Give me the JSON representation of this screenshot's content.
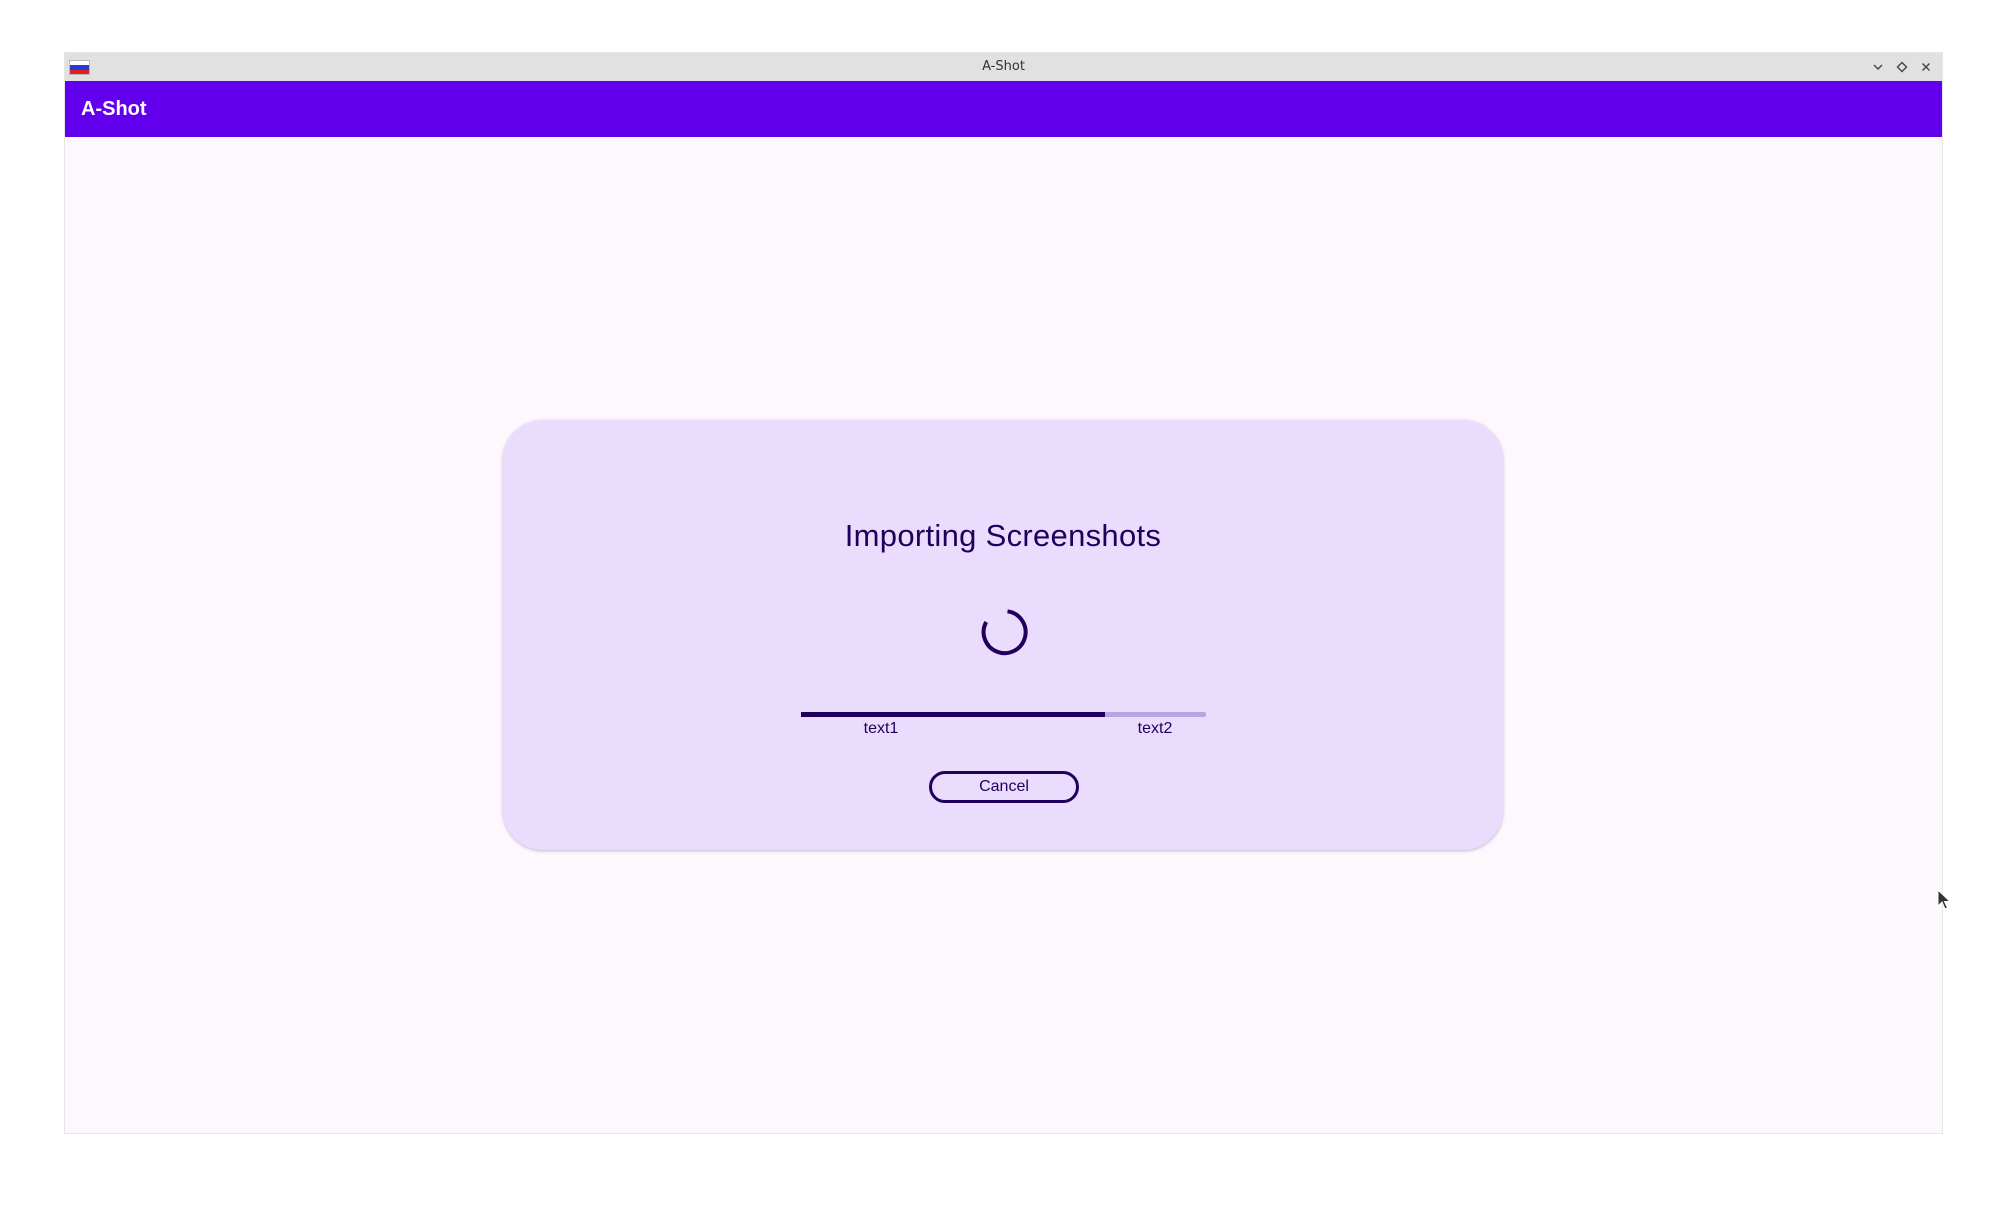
{
  "window": {
    "title": "A-Shot",
    "controls": [
      "minimize-icon",
      "maximize-icon",
      "close-icon"
    ],
    "flag_colors": [
      "#ffffff",
      "#1c3fd6",
      "#e12121"
    ]
  },
  "appbar": {
    "title": "A-Shot",
    "color": "#6200ee"
  },
  "dialog": {
    "title": "Importing Screenshots",
    "progress": 0.75,
    "progress_start_label": "text1",
    "progress_end_label": "text2",
    "cancel_label": "Cancel",
    "spinner_icon": "loading-spinner-icon",
    "accent_color": "#21005d",
    "card_color": "#eadcfd"
  }
}
